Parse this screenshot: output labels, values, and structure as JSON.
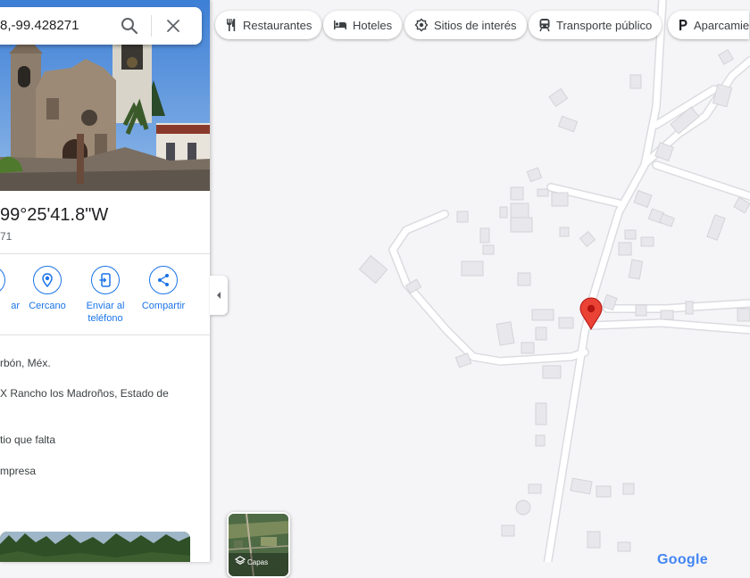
{
  "search": {
    "value": "8,-99.428271"
  },
  "place": {
    "coords_title": "99°25'41.8\"W",
    "coords_sub": "71"
  },
  "actions": [
    {
      "label": "ar"
    },
    {
      "label": "Cercano"
    },
    {
      "label": "Enviar al teléfono"
    },
    {
      "label": "Compartir"
    }
  ],
  "info": [
    "rbón, Méx.",
    "X Rancho los Madroños, Estado de",
    "tio que falta",
    "mpresa"
  ],
  "chips": [
    {
      "label": "Restaurantes",
      "icon": "fork-knife-icon"
    },
    {
      "label": "Hoteles",
      "icon": "bed-icon"
    },
    {
      "label": "Sitios de interés",
      "icon": "camera-icon"
    },
    {
      "label": "Transporte público",
      "icon": "train-icon"
    },
    {
      "label": "Aparcamie",
      "icon": "parking-icon"
    }
  ],
  "layers": {
    "label": "Capas"
  },
  "logo": "Google",
  "colors": {
    "accent": "#1a73e8",
    "pin": "#ea4335",
    "map_bg": "#f5f5f7",
    "road": "#ffffff"
  }
}
